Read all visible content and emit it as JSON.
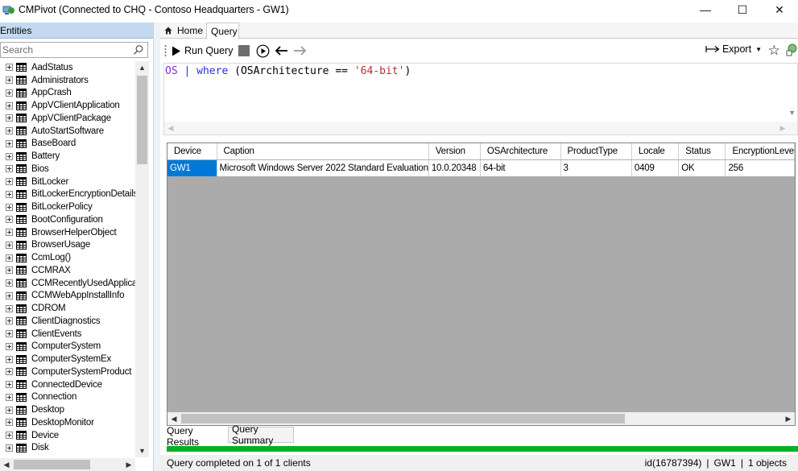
{
  "window": {
    "title": "CMPivot (Connected to CHQ - Contoso Headquarters - GW1)",
    "controls": {
      "minimize": "—",
      "maximize": "☐",
      "close": "✕"
    }
  },
  "left": {
    "header": "Entities",
    "search_placeholder": "Search",
    "items": [
      "AadStatus",
      "Administrators",
      "AppCrash",
      "AppVClientApplication",
      "AppVClientPackage",
      "AutoStartSoftware",
      "BaseBoard",
      "Battery",
      "Bios",
      "BitLocker",
      "BitLockerEncryptionDetails",
      "BitLockerPolicy",
      "BootConfiguration",
      "BrowserHelperObject",
      "BrowserUsage",
      "CcmLog()",
      "CCMRAX",
      "CCMRecentlyUsedApplicat",
      "CCMWebAppInstallInfo",
      "CDROM",
      "ClientDiagnostics",
      "ClientEvents",
      "ComputerSystem",
      "ComputerSystemEx",
      "ComputerSystemProduct",
      "ConnectedDevice",
      "Connection",
      "Desktop",
      "DesktopMonitor",
      "Device",
      "Disk"
    ]
  },
  "tabs": {
    "home": "Home",
    "query": "Query"
  },
  "toolbar": {
    "run": "Run Query",
    "export": "Export"
  },
  "editor": {
    "tokens": {
      "table": "OS",
      "pipe": " | ",
      "op": "where",
      "open": " (",
      "field": "OSArchitecture",
      "eq": " == ",
      "value": "'64-bit'",
      "close": ")"
    }
  },
  "results": {
    "columns": [
      "Device",
      "Caption",
      "Version",
      "OSArchitecture",
      "ProductType",
      "Locale",
      "Status",
      "EncryptionLeve"
    ],
    "rows": [
      [
        "GW1",
        "Microsoft Windows Server 2022 Standard Evaluation",
        "10.0.20348",
        "64-bit",
        "3",
        "0409",
        "OK",
        "256"
      ]
    ]
  },
  "bottom_tabs": {
    "results": "Query Results",
    "summary": "Query Summary"
  },
  "progress": {
    "fraction": 1.0,
    "color": "#06b025"
  },
  "status": {
    "message": "Query completed on 1 of 1 clients",
    "id": "id(16787394)",
    "device": "GW1",
    "objects": "1 objects"
  }
}
